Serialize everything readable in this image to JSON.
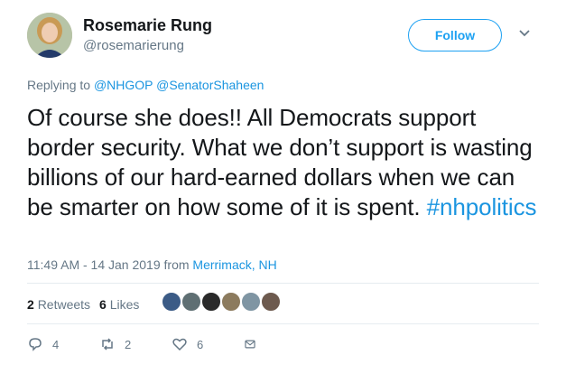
{
  "tweet": {
    "author_name": "Rosemarie Rung",
    "author_handle": "@rosemarierung",
    "follow_label": "Follow",
    "replying_to_prefix": "Replying to",
    "replying_to_1": "@NHGOP",
    "replying_to_2": "@SenatorShaheen",
    "text_main": "Of course she does!! All Democrats support border security. What we don’t support is wasting billions of our hard-earned dollars when we can be smarter on how some of it is spent.",
    "hashtag": "#nhpolitics",
    "timestamp": "11:49 AM - 14 Jan 2019",
    "location_prefix": "from",
    "location": "Merrimack, NH"
  },
  "stats": {
    "retweets_count": "2",
    "retweets_label": "Retweets",
    "likes_count": "6",
    "likes_label": "Likes"
  },
  "likers": [
    {
      "name": "liker-avatar-1",
      "color": "#3b5b86"
    },
    {
      "name": "liker-avatar-2",
      "color": "#5f6f73"
    },
    {
      "name": "liker-avatar-3",
      "color": "#2a2a2a"
    },
    {
      "name": "liker-avatar-4",
      "color": "#8c7b5e"
    },
    {
      "name": "liker-avatar-5",
      "color": "#7f95a3"
    },
    {
      "name": "liker-avatar-6",
      "color": "#6d5a4e"
    }
  ],
  "actions": {
    "reply_count": "4",
    "retweet_count": "2",
    "like_count": "6"
  },
  "colors": {
    "accent": "#1da1f2",
    "link": "#1b95e0",
    "muted": "#657786",
    "text": "#14171a",
    "divider": "#e6ecf0"
  }
}
